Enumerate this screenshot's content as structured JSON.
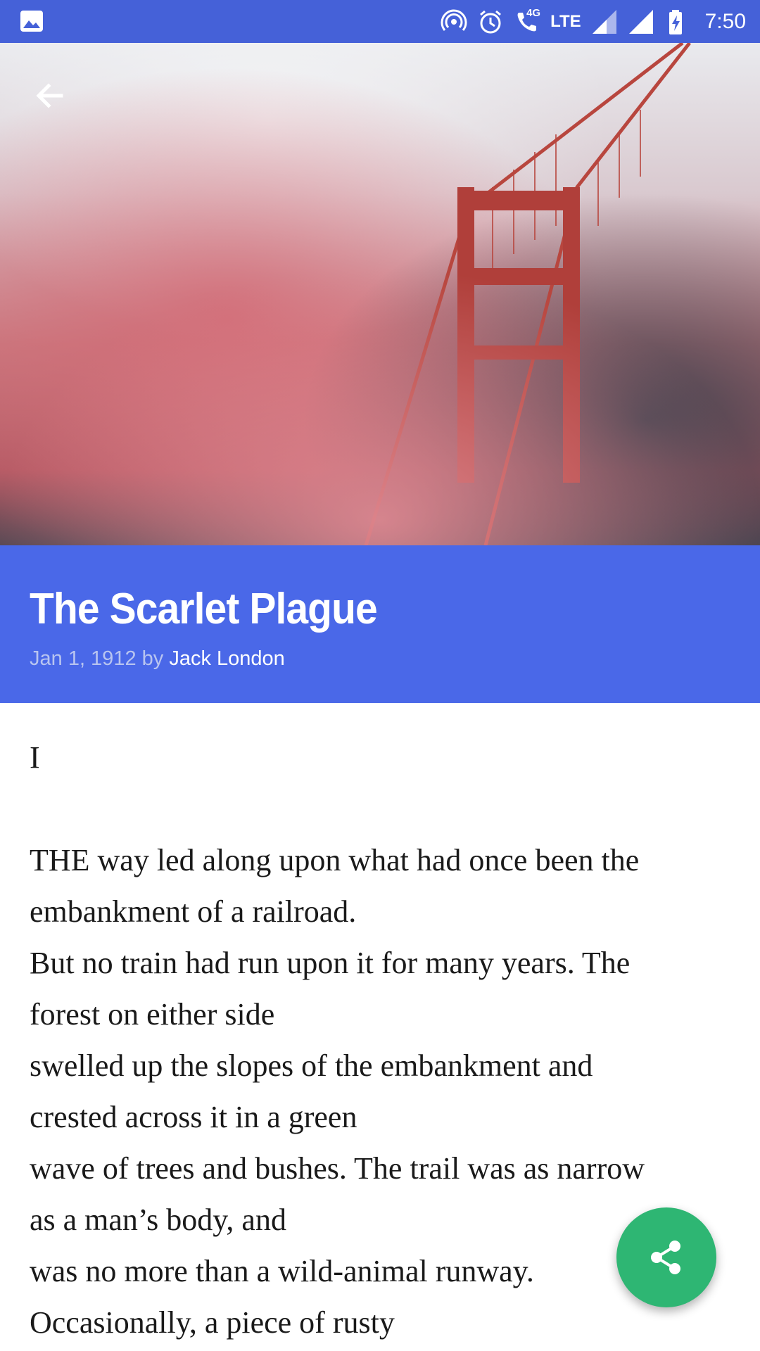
{
  "status_bar": {
    "left_icon": "image-icon",
    "icons": [
      "hotspot-icon",
      "alarm-icon",
      "wifi-calling-icon",
      "signal-icon",
      "signal-icon",
      "battery-charging-icon"
    ],
    "network_small": "4G",
    "network_label": "LTE",
    "time": "7:50",
    "background_color": "#4561d8"
  },
  "hero": {
    "image_subject": "golden-gate-bridge-in-fog",
    "back_icon": "back-arrow-icon"
  },
  "article": {
    "title": "The Scarlet Plague",
    "date": "Jan 1, 1912",
    "by_label": "by",
    "author": "Jack London",
    "band_color": "#4a68e8",
    "chapter": "I",
    "lines": [
      "THE way led along upon what had once been the",
      "embankment of a railroad.",
      "But no train had run upon it for many years. The",
      "forest on either side",
      "swelled up the slopes of the embankment and",
      "crested across it in a green",
      "wave of trees and bushes. The trail was as narrow",
      "as a man’s body, and",
      "was no more than a wild-animal runway.",
      "Occasionally, a piece of rusty"
    ]
  },
  "fab": {
    "icon": "share-icon",
    "color": "#2eb673"
  }
}
